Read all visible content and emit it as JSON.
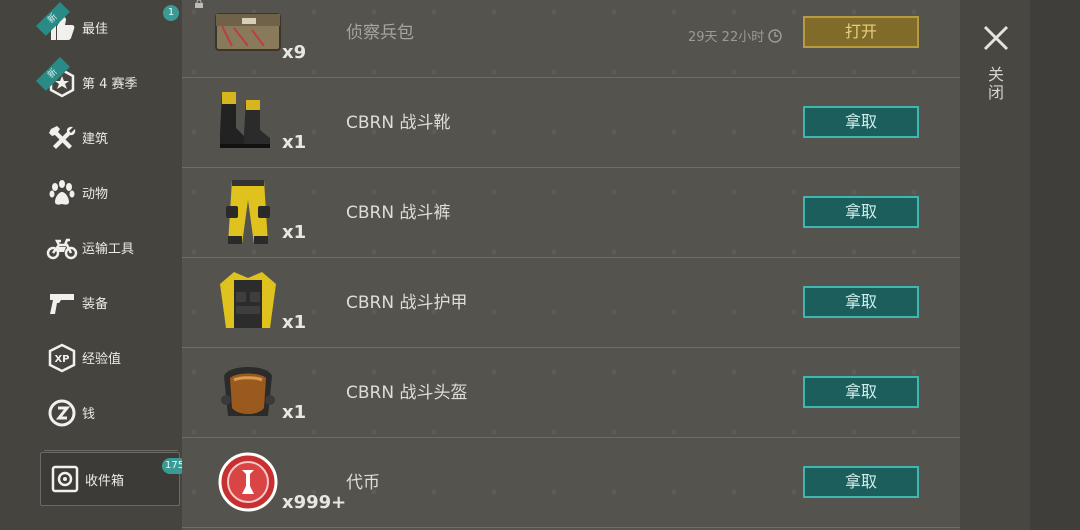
{
  "sidebar": {
    "items": [
      {
        "label": "最佳",
        "icon": "thumbs-up-icon",
        "badge": "1",
        "ribbon": "新"
      },
      {
        "label": "第 4 赛季",
        "icon": "season-star-icon",
        "ribbon": "新"
      },
      {
        "label": "建筑",
        "icon": "hammer-wrench-icon"
      },
      {
        "label": "动物",
        "icon": "paw-icon"
      },
      {
        "label": "运输工具",
        "icon": "motorcycle-icon"
      },
      {
        "label": "装备",
        "icon": "pistol-icon"
      },
      {
        "label": "经验值",
        "icon": "xp-icon"
      },
      {
        "label": "钱",
        "icon": "coin-icon"
      },
      {
        "label": "收件箱",
        "icon": "inbox-safe-icon",
        "badge": "175"
      }
    ]
  },
  "rows": [
    {
      "name": "侦察兵包",
      "qty": "x9",
      "icon": "crate-icon",
      "timer": "29天 22小时",
      "button": "打开"
    },
    {
      "name": "CBRN 战斗靴",
      "qty": "x1",
      "icon": "boots-icon",
      "button": "拿取"
    },
    {
      "name": "CBRN 战斗裤",
      "qty": "x1",
      "icon": "pants-icon",
      "button": "拿取"
    },
    {
      "name": "CBRN 战斗护甲",
      "qty": "x1",
      "icon": "armor-vest-icon",
      "button": "拿取"
    },
    {
      "name": "CBRN 战斗头盔",
      "qty": "x1",
      "icon": "helmet-icon",
      "button": "拿取"
    },
    {
      "name": "代币",
      "qty": "x999+",
      "icon": "token-cap-icon",
      "button": "拿取"
    }
  ],
  "close": {
    "label": "关闭"
  },
  "colors": {
    "take_button": "#1c5e5c",
    "open_button": "#816b2b",
    "badge": "#3a9b95"
  }
}
